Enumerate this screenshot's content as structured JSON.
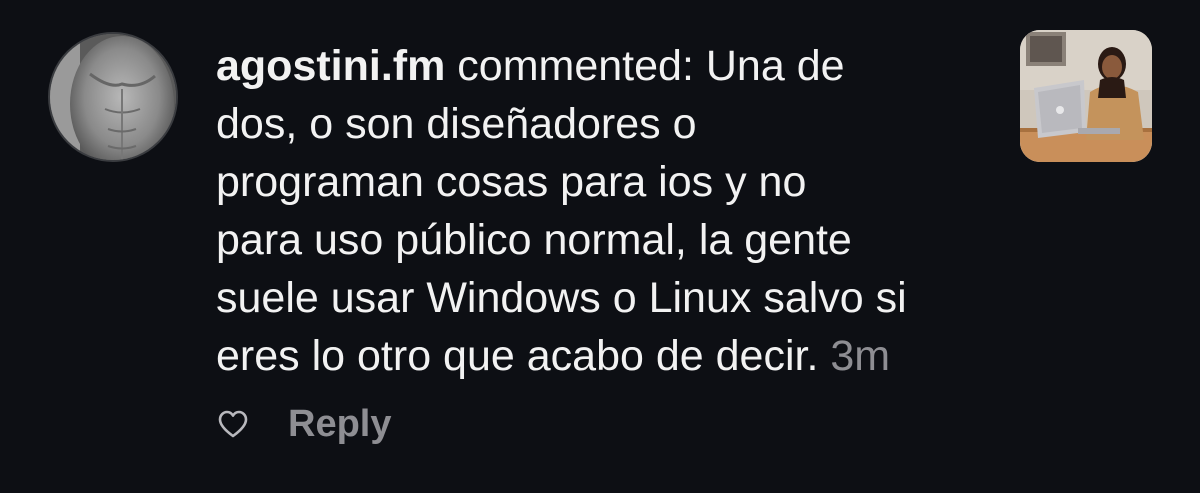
{
  "comment": {
    "username": "agostini.fm",
    "verb": "commented:",
    "lines": [
      "Una de",
      "dos, o son diseñadores o",
      "programan cosas para ios y no",
      "para uso público normal, la gente",
      "suele usar Windows o Linux salvo si",
      "eres lo otro que acabo de decir."
    ],
    "timestamp": "3m"
  },
  "actions": {
    "like_icon": "heart-outline-icon",
    "reply_label": "Reply"
  },
  "colors": {
    "background": "#0d0f14",
    "text": "#f2f2f2",
    "muted": "#8e8e93"
  }
}
